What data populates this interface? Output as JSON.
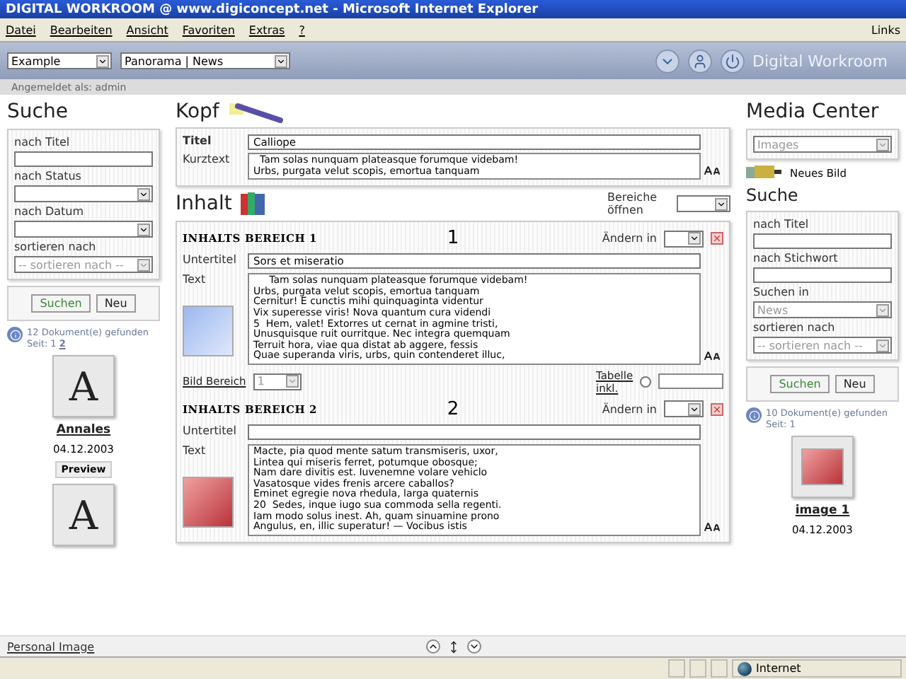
{
  "window": {
    "title": "DIGITAL WORKROOM @ www.digiconcept.net - Microsoft Internet Explorer"
  },
  "menu": [
    "Datei",
    "Bearbeiten",
    "Ansicht",
    "Favoriten",
    "Extras",
    "?"
  ],
  "links": "Links",
  "toolbar": {
    "selects": [
      "Example",
      "Panorama | News"
    ],
    "brand": "Digital Workroom"
  },
  "login": "Angemeldet als: admin",
  "left": {
    "title": "Suche",
    "fields": [
      {
        "label": "nach Titel",
        "kind": "text"
      },
      {
        "label": "nach Status",
        "kind": "select"
      },
      {
        "label": "nach Datum",
        "kind": "select"
      },
      {
        "label": "sortieren nach",
        "kind": "select",
        "value": "-- sortieren nach --"
      }
    ],
    "buttons": [
      "Suchen",
      "Neu"
    ],
    "result": "12 Dokument(e) gefunden",
    "pages_label": "Seit:",
    "pages": [
      {
        "label": "1",
        "selected": true
      },
      {
        "label": "2",
        "selected": false
      }
    ],
    "documents": [
      {
        "kind": "full",
        "thumbnail": "A",
        "title": "Annales",
        "date": "04.12.2003",
        "action": "Preview"
      },
      {
        "kind": "partial",
        "thumbnail": "A"
      }
    ]
  },
  "center": {
    "kopf": {
      "title": "Kopf",
      "titel_label": "Titel",
      "titel": "Calliope",
      "kurztext_label": "Kurztext",
      "kurztext": [
        "  Tam solas nunquam plateasque forumque videbam!",
        "Urbs, purgata velut scopis, emortua tanquam"
      ]
    },
    "inhalt": {
      "title": "Inhalt",
      "open_label": "Bereiche öffnen",
      "sections": [
        {
          "heading": "INHALTS BEREICH  1",
          "number": "1",
          "change_label": "Ändern in",
          "subtitle_label": "Untertitel",
          "subtitle": "Sors et miseratio",
          "text_label": "Text",
          "lines": [
            "     Tam solas nunquam plateasque forumque videbam!",
            "Urbs, purgata velut scopis, emortua tanquam",
            "Cernitur! E cunctis mihi quinquaginta videntur",
            "Vix superesse viris! Nova quantum cura videndi",
            "5  Hem, valet! Extorres ut cernat in agmine tristi,",
            "Unusquisque ruit ourritque. Nec integra quemquam",
            "Terruit hora, viae qua distat ab aggere, fessis",
            "Quae superanda viris, urbs, quin contenderet illuc,"
          ],
          "image_label": "Bild Bereich",
          "image_value": "1",
          "table_label": "Tabelle inkl.",
          "table_checked": false
        },
        {
          "heading": "INHALTS BEREICH  2",
          "number": "2",
          "change_label": "Ändern in",
          "subtitle_label": "Untertitel",
          "text_label": "Text",
          "lines": [
            "Macte, pia quod mente satum transmiseris, uxor,",
            "Lintea qui miseris ferret, potumque obosque;",
            "Nam dare divitis est. Iuvenemne volare vehiclo",
            "Vasatosque vides frenis arcere caballos?",
            "Eminet egregie nova rhedula, larga quaternis",
            "20  Sedes, inque iugo sua commoda sella regenti.",
            "Iam modo solus inest. Ah, quam sinuamine prono",
            "Angulus, en, illic superatur! — Vocibus istis"
          ]
        }
      ]
    }
  },
  "right": {
    "title": "Media Center",
    "category": "Images",
    "new_image": "Neues Bild",
    "search_title": "Suche",
    "fields": [
      {
        "label": "nach Titel",
        "kind": "text"
      },
      {
        "label": "nach Stichwort",
        "kind": "text"
      },
      {
        "label": "Suchen in",
        "kind": "select",
        "value": "News"
      },
      {
        "label": "sortieren nach",
        "kind": "select",
        "value": "-- sortieren nach --"
      }
    ],
    "buttons": [
      "Suchen",
      "Neu"
    ],
    "result": "10 Dokument(e) gefunden",
    "pages_label": "Seit: 1",
    "media": [
      {
        "title": "image 1",
        "date": "04.12.2003"
      }
    ]
  },
  "footer_link": "Personal Image",
  "status": "Internet"
}
